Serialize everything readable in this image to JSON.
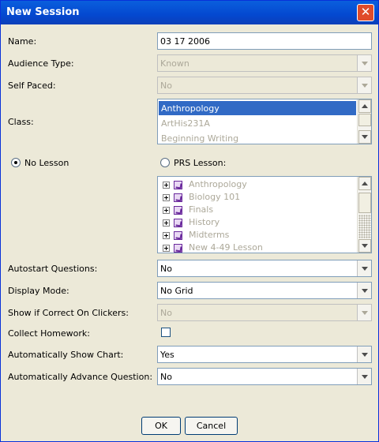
{
  "window": {
    "title": "New Session",
    "close_glyph": "✕"
  },
  "fields": {
    "name": {
      "label": "Name:",
      "value": "03 17 2006"
    },
    "audience_type": {
      "label": "Audience Type:",
      "value": "Known"
    },
    "self_paced": {
      "label": "Self Paced:",
      "value": "No"
    },
    "class": {
      "label": "Class:",
      "options": [
        "Anthropology",
        "ArtHis231A",
        "Beginning Writing"
      ]
    },
    "lesson": {
      "no_lesson_label": "No Lesson",
      "prs_lesson_label": "PRS Lesson:",
      "selected": "no_lesson",
      "items": [
        "Anthropology",
        "Biology 101",
        "Finals",
        "History",
        "Midterms",
        "New 4-49 Lesson"
      ]
    },
    "autostart_questions": {
      "label": "Autostart Questions:",
      "value": "No"
    },
    "display_mode": {
      "label": "Display Mode:",
      "value": "No Grid"
    },
    "show_if_correct": {
      "label": "Show if Correct On Clickers:",
      "value": "No"
    },
    "collect_homework": {
      "label": "Collect Homework:",
      "checked": false
    },
    "auto_show_chart": {
      "label": "Automatically Show Chart:",
      "value": "Yes"
    },
    "auto_advance_question": {
      "label": "Automatically Advance Question:",
      "value": "No"
    }
  },
  "buttons": {
    "ok": "OK",
    "cancel": "Cancel"
  },
  "icons": {
    "tree_item": "lesson-icon",
    "tree_toggle": "tree-expand-icon"
  },
  "colors": {
    "title_bar": "#0a5fdd",
    "selection": "#316ac5",
    "disabled_text": "#aca899",
    "lesson_icon": "#6a2a9c"
  }
}
